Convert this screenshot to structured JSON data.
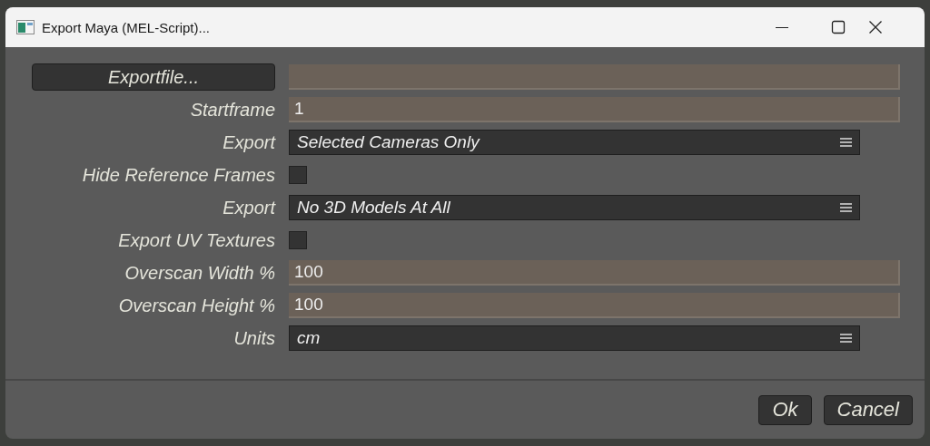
{
  "window": {
    "title": "Export Maya (MEL-Script)..."
  },
  "rows": [
    {
      "kind": "file",
      "button": "Exportfile..."
    },
    {
      "kind": "text",
      "label": "Startframe",
      "value": "1"
    },
    {
      "kind": "dropdown",
      "label": "Export",
      "value": "Selected Cameras Only"
    },
    {
      "kind": "checkbox",
      "label": "Hide Reference Frames",
      "checked": false
    },
    {
      "kind": "dropdown",
      "label": "Export",
      "value": "No 3D Models At All"
    },
    {
      "kind": "checkbox",
      "label": "Export UV Textures",
      "checked": false
    },
    {
      "kind": "text",
      "label": "Overscan Width %",
      "value": "100"
    },
    {
      "kind": "text",
      "label": "Overscan Height %",
      "value": "100"
    },
    {
      "kind": "dropdown",
      "label": "Units",
      "value": "cm"
    }
  ],
  "buttons": [
    "Ok",
    "Cancel"
  ]
}
